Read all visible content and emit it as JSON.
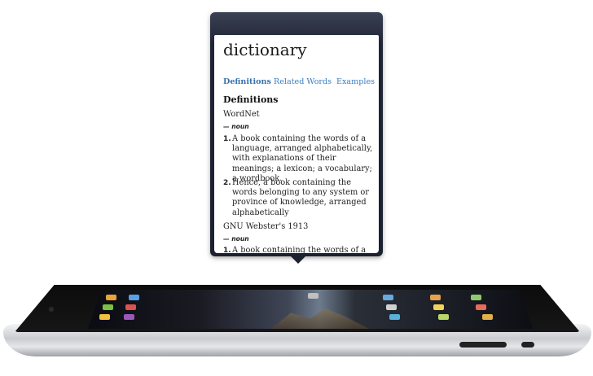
{
  "popover": {
    "title": "dictionary",
    "tabs": [
      "Definitions",
      "Related Words",
      "Examples"
    ],
    "active_tab": "Definitions",
    "section_heading": "Definitions",
    "entries": [
      {
        "source": "WordNet",
        "pos": "— noun",
        "defs": [
          {
            "num": "1.",
            "text": "A book containing the words of a language, arranged alphabetically, with explanations of their meanings; a lexicon; a vocabulary; a wordbook."
          },
          {
            "num": "2.",
            "text": "Hence, a book containing the words belonging to any system or province of knowledge, arranged alphabetically"
          }
        ]
      },
      {
        "source": "GNU Webster's 1913",
        "pos": "— noun",
        "defs": [
          {
            "num": "1.",
            "text": "A book containing the words of a language, arranged alphabetically,"
          }
        ]
      }
    ]
  },
  "device": {
    "name": "iPad",
    "colors": {
      "bezel": "#111111",
      "body": "#cfd1d5",
      "accent_link": "#3a7cbf"
    }
  }
}
